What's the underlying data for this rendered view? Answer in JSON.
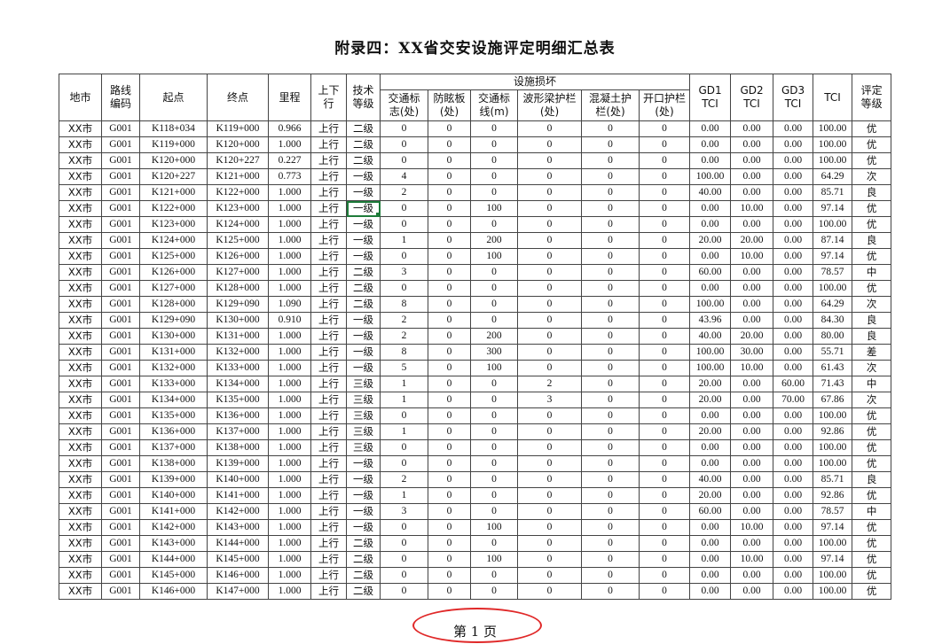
{
  "title": "附录四：XX省交安设施评定明细汇总表",
  "header": {
    "city": "地市",
    "route": "路线\n编码",
    "start": "起点",
    "end": "终点",
    "mileage": "里程",
    "direction": "上下\n行",
    "grade": "技术\n等级",
    "damage_group": "设施损坏",
    "sign": "交通标\n志(处)",
    "antiglare": "防眩板\n(处)",
    "marking": "交通标\n线(m)",
    "wave": "波形梁护栏\n(处)",
    "concrete": "混凝土护\n栏(处)",
    "opening": "开口护栏\n(处)",
    "gd1": "GD1\nTCI",
    "gd2": "GD2\nTCI",
    "gd3": "GD3\nTCI",
    "tci": "TCI",
    "rating": "评定\n等级"
  },
  "rows": [
    [
      "XX市",
      "G001",
      "K118+034",
      "K119+000",
      "0.966",
      "上行",
      "二级",
      "0",
      "0",
      "0",
      "0",
      "0",
      "0",
      "0.00",
      "0.00",
      "0.00",
      "100.00",
      "优"
    ],
    [
      "XX市",
      "G001",
      "K119+000",
      "K120+000",
      "1.000",
      "上行",
      "二级",
      "0",
      "0",
      "0",
      "0",
      "0",
      "0",
      "0.00",
      "0.00",
      "0.00",
      "100.00",
      "优"
    ],
    [
      "XX市",
      "G001",
      "K120+000",
      "K120+227",
      "0.227",
      "上行",
      "二级",
      "0",
      "0",
      "0",
      "0",
      "0",
      "0",
      "0.00",
      "0.00",
      "0.00",
      "100.00",
      "优"
    ],
    [
      "XX市",
      "G001",
      "K120+227",
      "K121+000",
      "0.773",
      "上行",
      "一级",
      "4",
      "0",
      "0",
      "0",
      "0",
      "0",
      "100.00",
      "0.00",
      "0.00",
      "64.29",
      "次"
    ],
    [
      "XX市",
      "G001",
      "K121+000",
      "K122+000",
      "1.000",
      "上行",
      "一级",
      "2",
      "0",
      "0",
      "0",
      "0",
      "0",
      "40.00",
      "0.00",
      "0.00",
      "85.71",
      "良"
    ],
    [
      "XX市",
      "G001",
      "K122+000",
      "K123+000",
      "1.000",
      "上行",
      "一级",
      "0",
      "0",
      "100",
      "0",
      "0",
      "0",
      "0.00",
      "10.00",
      "0.00",
      "97.14",
      "优"
    ],
    [
      "XX市",
      "G001",
      "K123+000",
      "K124+000",
      "1.000",
      "上行",
      "一级",
      "0",
      "0",
      "0",
      "0",
      "0",
      "0",
      "0.00",
      "0.00",
      "0.00",
      "100.00",
      "优"
    ],
    [
      "XX市",
      "G001",
      "K124+000",
      "K125+000",
      "1.000",
      "上行",
      "一级",
      "1",
      "0",
      "200",
      "0",
      "0",
      "0",
      "20.00",
      "20.00",
      "0.00",
      "87.14",
      "良"
    ],
    [
      "XX市",
      "G001",
      "K125+000",
      "K126+000",
      "1.000",
      "上行",
      "一级",
      "0",
      "0",
      "100",
      "0",
      "0",
      "0",
      "0.00",
      "10.00",
      "0.00",
      "97.14",
      "优"
    ],
    [
      "XX市",
      "G001",
      "K126+000",
      "K127+000",
      "1.000",
      "上行",
      "二级",
      "3",
      "0",
      "0",
      "0",
      "0",
      "0",
      "60.00",
      "0.00",
      "0.00",
      "78.57",
      "中"
    ],
    [
      "XX市",
      "G001",
      "K127+000",
      "K128+000",
      "1.000",
      "上行",
      "二级",
      "0",
      "0",
      "0",
      "0",
      "0",
      "0",
      "0.00",
      "0.00",
      "0.00",
      "100.00",
      "优"
    ],
    [
      "XX市",
      "G001",
      "K128+000",
      "K129+090",
      "1.090",
      "上行",
      "二级",
      "8",
      "0",
      "0",
      "0",
      "0",
      "0",
      "100.00",
      "0.00",
      "0.00",
      "64.29",
      "次"
    ],
    [
      "XX市",
      "G001",
      "K129+090",
      "K130+000",
      "0.910",
      "上行",
      "一级",
      "2",
      "0",
      "0",
      "0",
      "0",
      "0",
      "43.96",
      "0.00",
      "0.00",
      "84.30",
      "良"
    ],
    [
      "XX市",
      "G001",
      "K130+000",
      "K131+000",
      "1.000",
      "上行",
      "一级",
      "2",
      "0",
      "200",
      "0",
      "0",
      "0",
      "40.00",
      "20.00",
      "0.00",
      "80.00",
      "良"
    ],
    [
      "XX市",
      "G001",
      "K131+000",
      "K132+000",
      "1.000",
      "上行",
      "一级",
      "8",
      "0",
      "300",
      "0",
      "0",
      "0",
      "100.00",
      "30.00",
      "0.00",
      "55.71",
      "差"
    ],
    [
      "XX市",
      "G001",
      "K132+000",
      "K133+000",
      "1.000",
      "上行",
      "一级",
      "5",
      "0",
      "100",
      "0",
      "0",
      "0",
      "100.00",
      "10.00",
      "0.00",
      "61.43",
      "次"
    ],
    [
      "XX市",
      "G001",
      "K133+000",
      "K134+000",
      "1.000",
      "上行",
      "三级",
      "1",
      "0",
      "0",
      "2",
      "0",
      "0",
      "20.00",
      "0.00",
      "60.00",
      "71.43",
      "中"
    ],
    [
      "XX市",
      "G001",
      "K134+000",
      "K135+000",
      "1.000",
      "上行",
      "三级",
      "1",
      "0",
      "0",
      "3",
      "0",
      "0",
      "20.00",
      "0.00",
      "70.00",
      "67.86",
      "次"
    ],
    [
      "XX市",
      "G001",
      "K135+000",
      "K136+000",
      "1.000",
      "上行",
      "三级",
      "0",
      "0",
      "0",
      "0",
      "0",
      "0",
      "0.00",
      "0.00",
      "0.00",
      "100.00",
      "优"
    ],
    [
      "XX市",
      "G001",
      "K136+000",
      "K137+000",
      "1.000",
      "上行",
      "三级",
      "1",
      "0",
      "0",
      "0",
      "0",
      "0",
      "20.00",
      "0.00",
      "0.00",
      "92.86",
      "优"
    ],
    [
      "XX市",
      "G001",
      "K137+000",
      "K138+000",
      "1.000",
      "上行",
      "三级",
      "0",
      "0",
      "0",
      "0",
      "0",
      "0",
      "0.00",
      "0.00",
      "0.00",
      "100.00",
      "优"
    ],
    [
      "XX市",
      "G001",
      "K138+000",
      "K139+000",
      "1.000",
      "上行",
      "一级",
      "0",
      "0",
      "0",
      "0",
      "0",
      "0",
      "0.00",
      "0.00",
      "0.00",
      "100.00",
      "优"
    ],
    [
      "XX市",
      "G001",
      "K139+000",
      "K140+000",
      "1.000",
      "上行",
      "一级",
      "2",
      "0",
      "0",
      "0",
      "0",
      "0",
      "40.00",
      "0.00",
      "0.00",
      "85.71",
      "良"
    ],
    [
      "XX市",
      "G001",
      "K140+000",
      "K141+000",
      "1.000",
      "上行",
      "一级",
      "1",
      "0",
      "0",
      "0",
      "0",
      "0",
      "20.00",
      "0.00",
      "0.00",
      "92.86",
      "优"
    ],
    [
      "XX市",
      "G001",
      "K141+000",
      "K142+000",
      "1.000",
      "上行",
      "一级",
      "3",
      "0",
      "0",
      "0",
      "0",
      "0",
      "60.00",
      "0.00",
      "0.00",
      "78.57",
      "中"
    ],
    [
      "XX市",
      "G001",
      "K142+000",
      "K143+000",
      "1.000",
      "上行",
      "一级",
      "0",
      "0",
      "100",
      "0",
      "0",
      "0",
      "0.00",
      "10.00",
      "0.00",
      "97.14",
      "优"
    ],
    [
      "XX市",
      "G001",
      "K143+000",
      "K144+000",
      "1.000",
      "上行",
      "二级",
      "0",
      "0",
      "0",
      "0",
      "0",
      "0",
      "0.00",
      "0.00",
      "0.00",
      "100.00",
      "优"
    ],
    [
      "XX市",
      "G001",
      "K144+000",
      "K145+000",
      "1.000",
      "上行",
      "二级",
      "0",
      "0",
      "100",
      "0",
      "0",
      "0",
      "0.00",
      "10.00",
      "0.00",
      "97.14",
      "优"
    ],
    [
      "XX市",
      "G001",
      "K145+000",
      "K146+000",
      "1.000",
      "上行",
      "二级",
      "0",
      "0",
      "0",
      "0",
      "0",
      "0",
      "0.00",
      "0.00",
      "0.00",
      "100.00",
      "优"
    ],
    [
      "XX市",
      "G001",
      "K146+000",
      "K147+000",
      "1.000",
      "上行",
      "二级",
      "0",
      "0",
      "0",
      "0",
      "0",
      "0",
      "0.00",
      "0.00",
      "0.00",
      "100.00",
      "优"
    ]
  ],
  "footer": {
    "page_label": "第 1 页"
  },
  "colors": {
    "highlight_circle": "#e02828",
    "selection": "#1e7b3a"
  }
}
